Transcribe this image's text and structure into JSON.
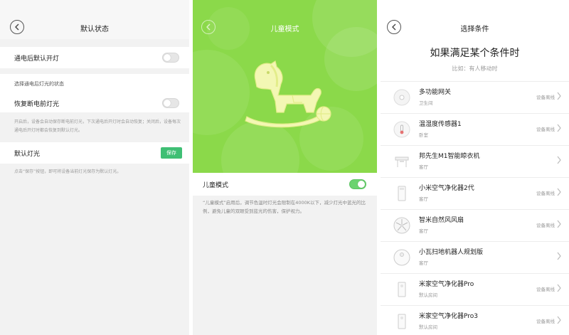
{
  "left_panel": {
    "title": "默认状态",
    "power_on_default_row": {
      "label": "通电后默认开灯",
      "enabled": false
    },
    "section_label": "选择通电后灯光的状态",
    "restore_row": {
      "label": "恢复断电前灯光",
      "enabled": false
    },
    "restore_hint": "开启后，设备会自动保存断电前灯光，下次通电后开灯时会自动恢复；关闭后，设备每次通电后开灯时都会恢复到默认灯光。",
    "default_light_row": {
      "label": "默认灯光",
      "save_label": "保存"
    },
    "save_hint": "点击“保存”按钮，即可将设备当前灯光保存为默认灯光。",
    "back_icon": "back-chevron-icon"
  },
  "middle_panel": {
    "title": "儿童模式",
    "hero_icon": "rocking-horse-icon",
    "switch_row": {
      "label": "儿童模式",
      "enabled": true
    },
    "description": "“儿童模式”启用后，调节色温时灯光会限制在4000K以下，减少灯光中蓝光的比例，避免儿童的双眼受到蓝光的伤害，保护视力。",
    "colors": {
      "hero_green": "#8bd94a",
      "toggle_on": "#6bd36f"
    }
  },
  "right_panel": {
    "title": "选择条件",
    "heading": "如果满足某个条件时",
    "example": "比如：有人移动时",
    "devices": [
      {
        "name": "多功能网关",
        "room": "卫生间",
        "status": "设备离线",
        "icon": "gateway-icon"
      },
      {
        "name": "温湿度传感器1",
        "room": "卧室",
        "status": "设备离线",
        "icon": "temperature-sensor-icon"
      },
      {
        "name": "邦先生M1智能晾衣机",
        "room": "客厅",
        "status": "",
        "icon": "clothes-dryer-icon"
      },
      {
        "name": "小米空气净化器2代",
        "room": "客厅",
        "status": "设备离线",
        "icon": "air-purifier-icon"
      },
      {
        "name": "智米自然风风扇",
        "room": "客厅",
        "status": "设备离线",
        "icon": "fan-icon"
      },
      {
        "name": "小瓦扫地机器人规划版",
        "room": "客厅",
        "status": "",
        "icon": "robot-vacuum-icon"
      },
      {
        "name": "米家空气净化器Pro",
        "room": "默认房间",
        "status": "设备离线",
        "icon": "air-purifier-pro-icon"
      },
      {
        "name": "米家空气净化器Pro3",
        "room": "默认房间",
        "status": "设备离线",
        "icon": "air-purifier-pro3-icon"
      }
    ]
  }
}
